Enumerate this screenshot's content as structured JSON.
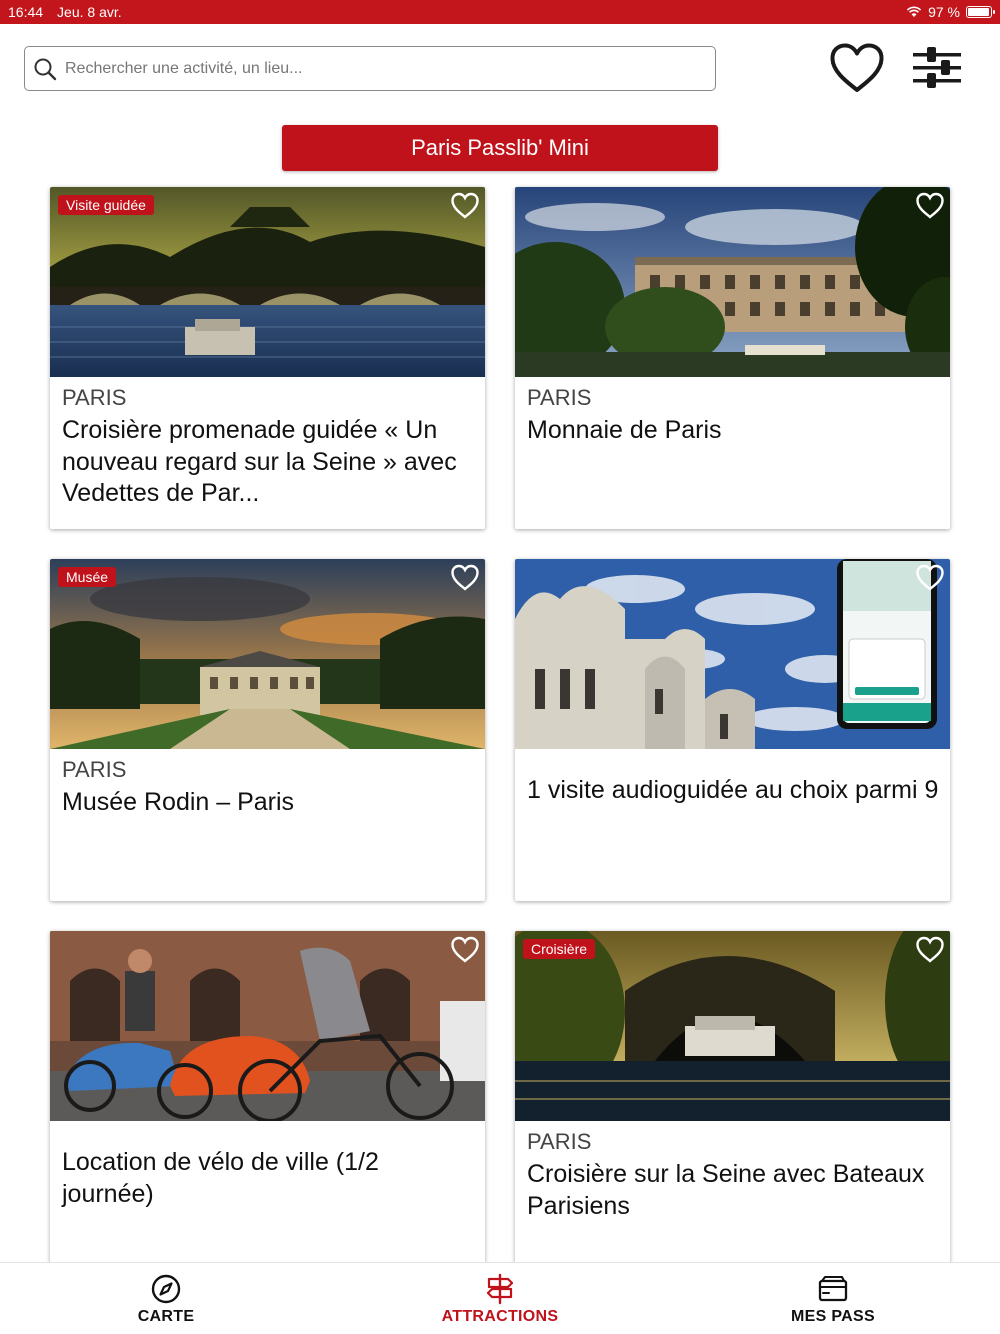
{
  "status_bar": {
    "time": "16:44",
    "date": "Jeu. 8 avr.",
    "battery": "97 %",
    "battery_level": 0.97
  },
  "search": {
    "placeholder": "Rechercher une activité, un lieu..."
  },
  "pass_button": {
    "label": "Paris Passlib' Mini"
  },
  "cards": [
    {
      "badge": "Visite guidée",
      "city": "PARIS",
      "title": "Croisière promenade guidée « Un nouveau regard sur la Seine » avec Vedettes de Par..."
    },
    {
      "badge": "",
      "city": "PARIS",
      "title": "Monnaie de Paris"
    },
    {
      "badge": "Musée",
      "city": "PARIS",
      "title": "Musée Rodin – Paris"
    },
    {
      "badge": "",
      "city": "",
      "title": "1 visite audioguidée au choix parmi 9"
    },
    {
      "badge": "",
      "city": "",
      "title": "Location de vélo de ville (1/2 journée)"
    },
    {
      "badge": "Croisière",
      "city": "PARIS",
      "title": "Croisière sur la Seine avec Bateaux Parisiens"
    }
  ],
  "bottom_nav": {
    "items": [
      {
        "label": "CARTE",
        "icon": "compass-icon",
        "active": false
      },
      {
        "label": "ATTRACTIONS",
        "icon": "signpost-icon",
        "active": true
      },
      {
        "label": "MES PASS",
        "icon": "wallet-icon",
        "active": false
      }
    ]
  },
  "colors": {
    "brand": "#c3161c",
    "active_nav": "#c0121a",
    "inactive_nav": "#111111"
  }
}
